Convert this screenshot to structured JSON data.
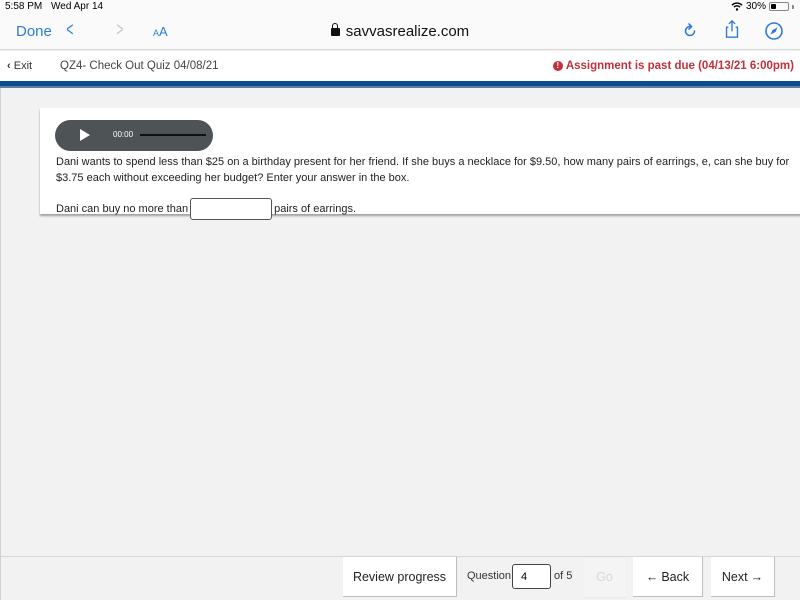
{
  "status_bar": {
    "time": "5:58 PM",
    "date": "Wed Apr 14",
    "battery": "30%",
    "wifi_icon": "wifi-icon",
    "battery_icon": "battery-icon"
  },
  "browser": {
    "done_label": "Done",
    "back_icon": "chevron-left-icon",
    "forward_icon": "chevron-right-icon",
    "text_size_small": "A",
    "text_size_large": "A",
    "url": "savvasrealize.com",
    "lock_icon": "lock-icon",
    "reload_icon": "reload-icon",
    "share_icon": "share-icon",
    "compass_icon": "compass-icon",
    "accent_color": "#2f7cd6"
  },
  "quiz_header": {
    "exit_label": "Exit",
    "title": "QZ4- Check Out Quiz 04/08/21",
    "due_notice": "Assignment is past due (04/13/21 6:00pm)",
    "due_color": "#c0313b",
    "band_color": "#0b4c8d"
  },
  "question": {
    "audio_time": "00:00",
    "text": "Dani wants to spend less than $25 on a birthday present for her friend. If she buys a necklace for $9.50, how many pairs of earrings, e, can she buy for $3.75 each without exceeding her budget? Enter your answer in the box.",
    "answer_prefix": "Dani can buy no more than",
    "answer_value": "",
    "answer_suffix": "pairs of earrings."
  },
  "footer": {
    "review_label": "Review progress",
    "question_label": "Question",
    "question_number": "4",
    "of_label": "of 5",
    "go_label": "Go",
    "back_label": "Back",
    "next_label": "Next"
  }
}
